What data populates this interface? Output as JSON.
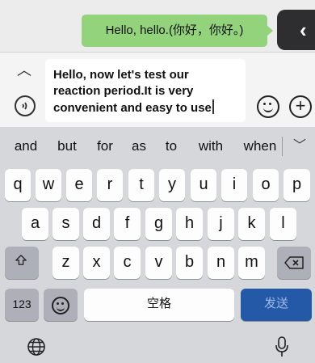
{
  "chat": {
    "message": "Hello, hello.(你好，你好。)"
  },
  "input": {
    "text": "Hello, now let's test our reaction period.It is very convenient and easy to use"
  },
  "suggestions": [
    "and",
    "but",
    "for",
    "as",
    "to",
    "with",
    "when"
  ],
  "keyboard": {
    "row1": [
      "q",
      "w",
      "e",
      "r",
      "t",
      "y",
      "u",
      "i",
      "o",
      "p"
    ],
    "row2": [
      "a",
      "s",
      "d",
      "f",
      "g",
      "h",
      "j",
      "k",
      "l"
    ],
    "row3": [
      "z",
      "x",
      "c",
      "v",
      "b",
      "n",
      "m"
    ],
    "numbers_label": "123",
    "space_label": "空格",
    "send_label": "发送"
  },
  "colors": {
    "bubble": "#93d37c",
    "send_key": "#2459a8",
    "keyboard_bg": "#d6d7db"
  },
  "icons": {
    "handle": "chevron-left-icon",
    "collapse": "chevron-up-icon",
    "voice": "voice-icon",
    "emoji": "emoji-icon",
    "plus": "plus-icon",
    "shift": "shift-icon",
    "backspace": "backspace-icon",
    "globe": "globe-icon",
    "mic": "microphone-icon"
  }
}
